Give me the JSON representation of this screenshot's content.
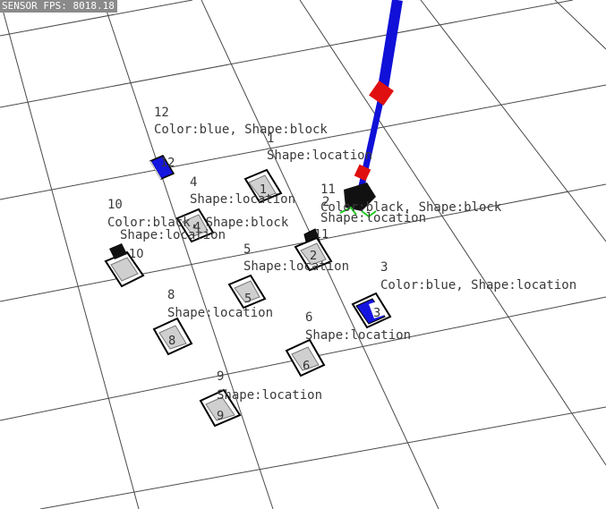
{
  "overlay": {
    "fps_text": "SENSOR FPS: 8018.18"
  },
  "colors": {
    "background": "#ffffff",
    "grid": "#4a4a4a",
    "arm": "#1010d8",
    "joint": "#e01010",
    "object_blue": "#1515e0",
    "object_black": "#111111",
    "gripper_green": "#22cc22"
  },
  "objects": [
    {
      "id": "12",
      "color": "blue",
      "shape": "block",
      "lines": [
        "12",
        "Color:blue, Shape:block"
      ],
      "marker": "12"
    },
    {
      "id": "1",
      "color": "",
      "shape": "location",
      "lines": [
        "1",
        "Shape:location"
      ],
      "marker": "1"
    },
    {
      "id": "4",
      "color": "black",
      "shape": "block",
      "lines": [
        "4",
        "Shape:location",
        "Color:black, Shape:block"
      ],
      "marker": "4"
    },
    {
      "id": "10",
      "color": "",
      "shape": "location",
      "lines": [
        "10",
        "Shape:location"
      ],
      "marker": "10"
    },
    {
      "id": "11",
      "color": "black",
      "shape": "block",
      "lines": [
        "11",
        "Color:black, Shape:block"
      ],
      "marker": "11"
    },
    {
      "id": "2",
      "color": "",
      "shape": "location",
      "lines": [
        "2",
        "Shape:location"
      ],
      "marker": "2"
    },
    {
      "id": "5",
      "color": "",
      "shape": "location",
      "lines": [
        "5",
        "Shape:location"
      ],
      "marker": "5"
    },
    {
      "id": "3",
      "color": "blue",
      "shape": "location",
      "lines": [
        "3",
        "Color:blue, Shape:location"
      ],
      "marker": "3"
    },
    {
      "id": "8",
      "color": "",
      "shape": "location",
      "lines": [
        "8",
        "Shape:location"
      ],
      "marker": "8"
    },
    {
      "id": "6",
      "color": "",
      "shape": "location",
      "lines": [
        "6",
        "Shape:location"
      ],
      "marker": "6"
    },
    {
      "id": "9",
      "color": "",
      "shape": "location",
      "lines": [
        "9",
        "Shape:location"
      ],
      "marker": "9"
    }
  ]
}
